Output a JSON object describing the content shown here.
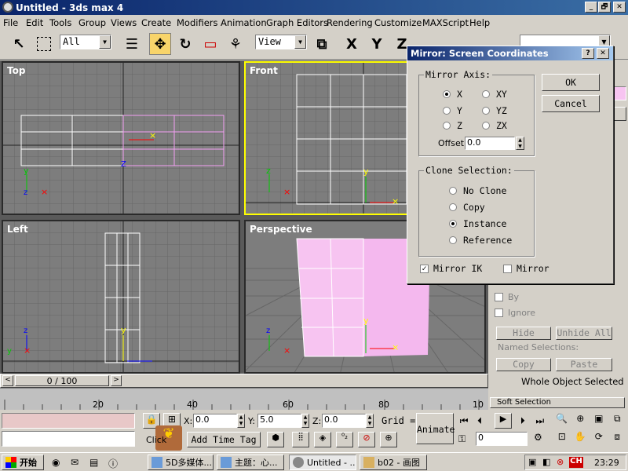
{
  "window": {
    "title": "Untitled - 3ds max 4",
    "minimize": "_",
    "restore": "🗗",
    "close": "✕"
  },
  "menu": [
    "File",
    "Edit",
    "Tools",
    "Group",
    "Views",
    "Create",
    "Modifiers",
    "Animation",
    "Graph Editors",
    "Rendering",
    "Customize",
    "MAXScript",
    "Help"
  ],
  "toolbar": {
    "selection_filter": "All",
    "ref_coord": "View",
    "axis_x": "X",
    "axis_y": "Y",
    "axis_z": "Z"
  },
  "viewports": {
    "top": "Top",
    "front": "Front",
    "left": "Left",
    "perspective": "Perspective"
  },
  "dialog": {
    "title": "Mirror: Screen Coordinates",
    "help": "?",
    "close": "✕",
    "mirror_axis": {
      "label": "Mirror Axis:",
      "options": [
        "X",
        "Y",
        "Z",
        "XY",
        "YZ",
        "ZX"
      ],
      "selected": "X",
      "offset_label": "Offset:",
      "offset_value": "0.0"
    },
    "clone": {
      "label": "Clone Selection:",
      "options": [
        "No Clone",
        "Copy",
        "Instance",
        "Reference"
      ],
      "selected": "Instance"
    },
    "mirror_ik": "Mirror IK",
    "mirror": "Mirror",
    "ok": "OK",
    "cancel": "Cancel"
  },
  "command_panel": {
    "by": "By",
    "ignore": "Ignore",
    "hide": "Hide",
    "unhide_all": "Unhide All",
    "named_selections": "Named Selections:",
    "copy": "Copy",
    "paste": "Paste",
    "whole_object": "Whole Object Selected",
    "soft_selection": "Soft Selection"
  },
  "timeline": {
    "frame": "0 / 100",
    "ticks": [
      "20",
      "40",
      "60",
      "80",
      "10"
    ]
  },
  "status": {
    "x_label": "X:",
    "x": "0.0",
    "y_label": "Y:",
    "y": "5.0",
    "z_label": "Z:",
    "z": "0.0",
    "grid_label": "Grid =",
    "animate": "Animate",
    "add_time_tag": "Add Time Tag",
    "click_hint": "Click",
    "frame_field": "0"
  },
  "taskbar": {
    "start": "开始",
    "tasks": [
      "5D多媒体...",
      "主题：心...",
      "Untitled - ...",
      "b02 - 画图"
    ],
    "tray_lang": "CH",
    "clock": "23:29"
  }
}
